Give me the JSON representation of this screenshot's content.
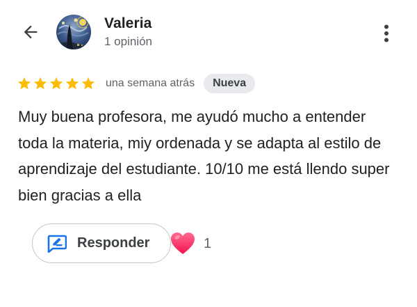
{
  "reviewer": {
    "name": "Valeria",
    "meta": "1 opinión",
    "avatar_icon": "avatar-starry-night"
  },
  "review": {
    "rating": 5,
    "max_rating": 5,
    "time": "una semana atrás",
    "badge": "Nueva",
    "text": "Muy buena profesora, me ayudó mucho a entender toda la materia, miy ordenada y se adapta al estilo de aprendizaje del estudiante. 10/10 me está llendo super bien gracias a ella"
  },
  "actions": {
    "reply_label": "Responder",
    "reply_icon": "reply-edit-icon",
    "reaction_icon": "heart-icon",
    "reaction_count": "1",
    "back_icon": "back-arrow-icon",
    "more_icon": "more-vert-icon"
  },
  "colors": {
    "star": "#fbbc04",
    "accent": "#1a73e8",
    "heart": "#ff3d71",
    "badge_bg": "#e8eaed",
    "secondary_text": "#5f6368"
  }
}
